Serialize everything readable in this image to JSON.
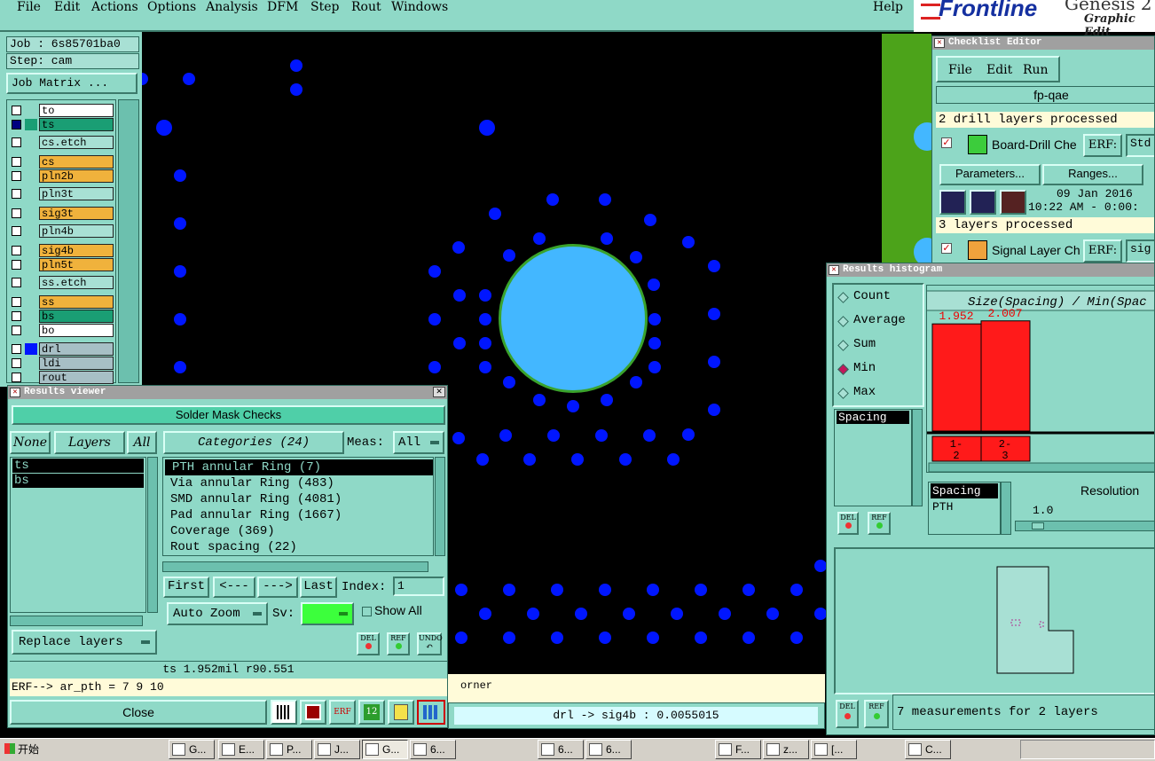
{
  "menu": {
    "file": "File",
    "edit": "Edit",
    "actions": "Actions",
    "options": "Options",
    "analysis": "Analysis",
    "dfm": "DFM",
    "step": "Step",
    "rout": "Rout",
    "windows": "Windows",
    "help": "Help"
  },
  "brand": {
    "logo": "Frontline",
    "product": "Genesis 2",
    "subtitle": "Graphic Edit"
  },
  "job": {
    "job": "Job : 6s85701ba0",
    "step": "Step: cam",
    "matrix_btn": "Job Matrix ..."
  },
  "layers": [
    {
      "name": "to",
      "color": "#ffffff"
    },
    {
      "name": "ts",
      "color": "#1a9e74"
    },
    {
      "name": "cs.etch",
      "color": "#a8e0d4"
    },
    {
      "name": "cs",
      "color": "#f0b23c"
    },
    {
      "name": "pln2b",
      "color": "#f0b23c"
    },
    {
      "name": "pln3t",
      "color": "#a8e0d4"
    },
    {
      "name": "sig3t",
      "color": "#f0b23c"
    },
    {
      "name": "pln4b",
      "color": "#a8e0d4"
    },
    {
      "name": "sig4b",
      "color": "#f0b23c"
    },
    {
      "name": "pln5t",
      "color": "#f0b23c"
    },
    {
      "name": "ss.etch",
      "color": "#a8e0d4"
    },
    {
      "name": "ss",
      "color": "#f0b23c"
    },
    {
      "name": "bs",
      "color": "#1a9e74"
    },
    {
      "name": "bo",
      "color": "#ffffff"
    },
    {
      "name": "drl",
      "color": "#a7bfc5"
    },
    {
      "name": "ldi",
      "color": "#a7bfc5"
    },
    {
      "name": "rout",
      "color": "#a7bfc5"
    }
  ],
  "status": {
    "erf_note": "orner",
    "drl_status": "drl -> sig4b : 0.0055015"
  },
  "results_viewer": {
    "title": "Results viewer",
    "header": "Solder Mask Checks",
    "none": "None",
    "layers": "Layers",
    "all": "All",
    "categories": "Categories (24)",
    "meas_label": "Meas:",
    "meas_value": "All",
    "layer_list": [
      "ts",
      "bs"
    ],
    "category_list": [
      "PTH annular Ring (7)",
      "Via annular Ring (483)",
      "SMD annular Ring (4081)",
      "Pad annular Ring (1667)",
      "Coverage (369)",
      "Rout spacing (22)"
    ],
    "first": "First",
    "prev": "<---",
    "next": "--->",
    "last": "Last",
    "index_label": "Index:",
    "index_value": "1",
    "auto_zoom": "Auto Zoom",
    "sv": "Sv:",
    "show_all": "Show All",
    "replace_layers": "Replace layers",
    "del": "DEL",
    "ref": "REF",
    "undo": "UNDO",
    "measure": "ts 1.952mil  r90.551",
    "erf": "ERF--> ar_pth = 7 9 10",
    "close": "Close"
  },
  "checklist": {
    "title": "Checklist Editor",
    "file": "File",
    "edit": "Edit",
    "run": "Run",
    "name": "fp-qae",
    "msg1": "2 drill layers processed",
    "check1": "Board-Drill Che",
    "erf": "ERF:",
    "erf_val1": "Std",
    "params": "Parameters...",
    "ranges": "Ranges...",
    "date": "09 Jan 2016",
    "time": "10:22 AM - 0:00:",
    "msg2": "3 layers processed",
    "check2": "Signal Layer Ch",
    "erf_val2": "sig"
  },
  "histogram": {
    "title": "Results histogram",
    "options": [
      "Count",
      "Average",
      "Sum",
      "Min",
      "Max"
    ],
    "selected": "Min",
    "chart_title": "Size(Spacing) / Min(Spac",
    "list1": [
      "Spacing"
    ],
    "list2": [
      "Spacing",
      "PTH"
    ],
    "resolution_label": "Resolution",
    "resolution": "1.0",
    "summary": "7 measurements for 2 layers",
    "del": "DEL",
    "ref": "REF"
  },
  "chart_data": {
    "type": "bar",
    "title": "Size(Spacing) / Min(Spac",
    "categories": [
      "1-2",
      "2-3"
    ],
    "values": [
      1.952,
      2.007
    ],
    "value_labels": [
      "1.952",
      "2.007"
    ],
    "bar_color": "#ff1a1a"
  },
  "taskbar": {
    "start": "开始",
    "items": [
      "G...",
      "E...",
      "P...",
      "J...",
      "G...",
      "6...",
      "6...",
      "6...",
      "F...",
      "z...",
      "[...",
      "C..."
    ]
  }
}
